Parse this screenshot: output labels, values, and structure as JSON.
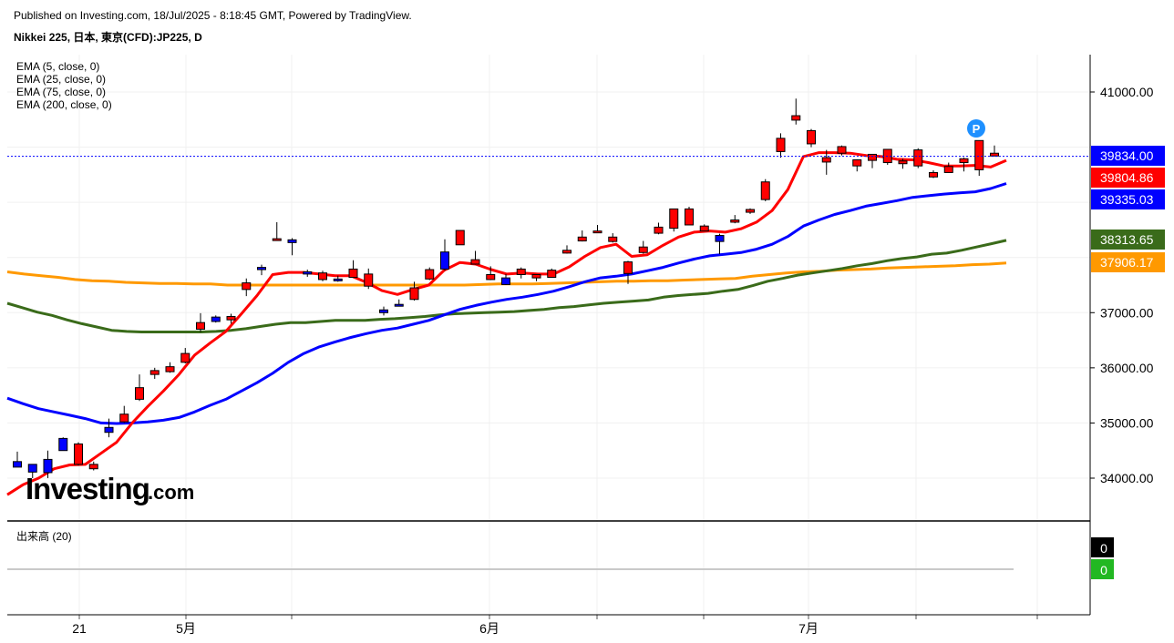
{
  "header": {
    "published": "Published on Investing.com, 18/Jul/2025 - 8:18:45 GMT, Powered by TradingView.",
    "symbol": "Nikkei 225, 日本, 東京(CFD):JP225, D"
  },
  "legend": [
    "EMA (5, close, 0)",
    "EMA (25, close, 0)",
    "EMA (75, close, 0)",
    "EMA (200, close, 0)"
  ],
  "volume_pane": {
    "label": "出来高 (20)",
    "values": [
      "0",
      "0"
    ],
    "colors": [
      "#000000",
      "#22b822"
    ]
  },
  "watermark": {
    "brand": "Investing",
    "suffix": ".com"
  },
  "marker_label": "P",
  "colors": {
    "up": "#ff0000",
    "down": "#0000ff",
    "ema5": "#ff0000",
    "ema25": "#0000ff",
    "ema75": "#3a6b1a",
    "ema200": "#ff9900",
    "current": "#0000ff"
  },
  "chart_data": {
    "type": "candlestick",
    "y_ticks": [
      "34000.00",
      "35000.00",
      "36000.00",
      "37000.00",
      "41000.00"
    ],
    "x_ticks": [
      "21",
      "5月",
      "6月",
      "7月"
    ],
    "ylim": [
      33150,
      41450
    ],
    "price_labels": [
      {
        "text": "39834.00",
        "value": 39834,
        "bg": "#0000ff"
      },
      {
        "text": "39804.86",
        "value": 39805,
        "bg": "#ff0000"
      },
      {
        "text": "39335.03",
        "value": 39335,
        "bg": "#0000ff"
      },
      {
        "text": "38313.65",
        "value": 38314,
        "bg": "#3a6b1a"
      },
      {
        "text": "37906.17",
        "value": 37906,
        "bg": "#ff9900"
      }
    ],
    "candles": [
      {
        "o": 34200,
        "h": 34480,
        "l": 34200,
        "c": 34300
      },
      {
        "o": 34110,
        "h": 34250,
        "l": 34000,
        "c": 34250
      },
      {
        "o": 34100,
        "h": 34500,
        "l": 34000,
        "c": 34340
      },
      {
        "o": 34500,
        "h": 34740,
        "l": 34500,
        "c": 34720
      },
      {
        "o": 34620,
        "h": 34650,
        "l": 34230,
        "c": 34250
      },
      {
        "o": 34250,
        "h": 34300,
        "l": 34140,
        "c": 34170
      },
      {
        "o": 34830,
        "h": 35080,
        "l": 34740,
        "c": 34920
      },
      {
        "o": 35160,
        "h": 35310,
        "l": 35000,
        "c": 35020
      },
      {
        "o": 35640,
        "h": 35880,
        "l": 35400,
        "c": 35430
      },
      {
        "o": 35950,
        "h": 36000,
        "l": 35800,
        "c": 35880
      },
      {
        "o": 36020,
        "h": 36100,
        "l": 35910,
        "c": 35930
      },
      {
        "o": 36260,
        "h": 36360,
        "l": 36080,
        "c": 36100
      },
      {
        "o": 36820,
        "h": 36990,
        "l": 36650,
        "c": 36700
      },
      {
        "o": 36840,
        "h": 36950,
        "l": 36820,
        "c": 36920
      },
      {
        "o": 36930,
        "h": 36980,
        "l": 36800,
        "c": 36870
      },
      {
        "o": 37540,
        "h": 37620,
        "l": 37300,
        "c": 37420
      },
      {
        "o": 37780,
        "h": 37870,
        "l": 37680,
        "c": 37820
      },
      {
        "o": 38340,
        "h": 38640,
        "l": 38320,
        "c": 38320
      },
      {
        "o": 38270,
        "h": 38350,
        "l": 38040,
        "c": 38320
      },
      {
        "o": 37700,
        "h": 37780,
        "l": 37650,
        "c": 37740
      },
      {
        "o": 37720,
        "h": 37760,
        "l": 37570,
        "c": 37600
      },
      {
        "o": 37590,
        "h": 37670,
        "l": 37560,
        "c": 37610
      },
      {
        "o": 37790,
        "h": 37950,
        "l": 37670,
        "c": 37640
      },
      {
        "o": 37700,
        "h": 37800,
        "l": 37430,
        "c": 37480
      },
      {
        "o": 37000,
        "h": 37110,
        "l": 36950,
        "c": 37050
      },
      {
        "o": 37150,
        "h": 37240,
        "l": 37170,
        "c": 37150
      },
      {
        "o": 37450,
        "h": 37560,
        "l": 37220,
        "c": 37240
      },
      {
        "o": 37780,
        "h": 37820,
        "l": 37590,
        "c": 37610
      },
      {
        "o": 37790,
        "h": 38330,
        "l": 37760,
        "c": 38100
      },
      {
        "o": 38490,
        "h": 38490,
        "l": 38270,
        "c": 38230
      },
      {
        "o": 37960,
        "h": 38120,
        "l": 37870,
        "c": 37880
      },
      {
        "o": 37690,
        "h": 37840,
        "l": 37590,
        "c": 37600
      },
      {
        "o": 37510,
        "h": 37700,
        "l": 37500,
        "c": 37630
      },
      {
        "o": 37790,
        "h": 37820,
        "l": 37620,
        "c": 37690
      },
      {
        "o": 37690,
        "h": 37660,
        "l": 37570,
        "c": 37630
      },
      {
        "o": 37770,
        "h": 37800,
        "l": 37650,
        "c": 37640
      },
      {
        "o": 38130,
        "h": 38220,
        "l": 38070,
        "c": 38080
      },
      {
        "o": 38370,
        "h": 38490,
        "l": 38290,
        "c": 38300
      },
      {
        "o": 38480,
        "h": 38590,
        "l": 38450,
        "c": 38450
      },
      {
        "o": 38370,
        "h": 38440,
        "l": 38270,
        "c": 38290
      },
      {
        "o": 37920,
        "h": 37940,
        "l": 37520,
        "c": 37710
      },
      {
        "o": 38190,
        "h": 38300,
        "l": 38070,
        "c": 38090
      },
      {
        "o": 38550,
        "h": 38630,
        "l": 38420,
        "c": 38440
      },
      {
        "o": 38880,
        "h": 38880,
        "l": 38470,
        "c": 38530
      },
      {
        "o": 38880,
        "h": 38920,
        "l": 38590,
        "c": 38590
      },
      {
        "o": 38570,
        "h": 38600,
        "l": 38490,
        "c": 38480
      },
      {
        "o": 38290,
        "h": 38430,
        "l": 38060,
        "c": 38400
      },
      {
        "o": 38680,
        "h": 38770,
        "l": 38620,
        "c": 38640
      },
      {
        "o": 38870,
        "h": 38890,
        "l": 38790,
        "c": 38820
      },
      {
        "o": 39370,
        "h": 39420,
        "l": 39020,
        "c": 39050
      },
      {
        "o": 40160,
        "h": 40250,
        "l": 39810,
        "c": 39920
      },
      {
        "o": 40570,
        "h": 40880,
        "l": 40410,
        "c": 40490
      },
      {
        "o": 40300,
        "h": 40330,
        "l": 40000,
        "c": 40060
      },
      {
        "o": 39810,
        "h": 39950,
        "l": 39500,
        "c": 39730
      },
      {
        "o": 40010,
        "h": 40030,
        "l": 39850,
        "c": 39890
      },
      {
        "o": 39770,
        "h": 39780,
        "l": 39560,
        "c": 39660
      },
      {
        "o": 39870,
        "h": 39870,
        "l": 39620,
        "c": 39760
      },
      {
        "o": 39960,
        "h": 39960,
        "l": 39680,
        "c": 39720
      },
      {
        "o": 39750,
        "h": 39790,
        "l": 39610,
        "c": 39700
      },
      {
        "o": 39950,
        "h": 39980,
        "l": 39620,
        "c": 39660
      },
      {
        "o": 39540,
        "h": 39580,
        "l": 39440,
        "c": 39460
      },
      {
        "o": 39650,
        "h": 39720,
        "l": 39550,
        "c": 39540
      },
      {
        "o": 39790,
        "h": 39810,
        "l": 39560,
        "c": 39720
      },
      {
        "o": 40120,
        "h": 40120,
        "l": 39480,
        "c": 39590
      },
      {
        "o": 39890,
        "h": 40030,
        "l": 39850,
        "c": 39840
      }
    ],
    "ema5": [
      33700,
      33880,
      34000,
      34170,
      34240,
      34250,
      34450,
      34650,
      35000,
      35300,
      35580,
      35880,
      36230,
      36450,
      36660,
      36980,
      37310,
      37690,
      37730,
      37730,
      37700,
      37670,
      37670,
      37550,
      37400,
      37330,
      37420,
      37500,
      37770,
      37910,
      37880,
      37780,
      37700,
      37720,
      37700,
      37700,
      37830,
      38020,
      38180,
      38240,
      38020,
      38050,
      38220,
      38370,
      38460,
      38480,
      38460,
      38520,
      38640,
      38850,
      39230,
      39830,
      39900,
      39900,
      39890,
      39850,
      39830,
      39780,
      39770,
      39720,
      39660,
      39660,
      39670,
      39640,
      39760
    ],
    "ema25": [
      35450,
      35350,
      35260,
      35200,
      35140,
      35080,
      35000,
      34990,
      35000,
      35020,
      35050,
      35100,
      35200,
      35320,
      35430,
      35580,
      35730,
      35900,
      36100,
      36260,
      36380,
      36470,
      36550,
      36620,
      36680,
      36720,
      36790,
      36860,
      36960,
      37060,
      37130,
      37190,
      37240,
      37280,
      37330,
      37390,
      37470,
      37560,
      37630,
      37660,
      37700,
      37760,
      37820,
      37900,
      37970,
      38030,
      38060,
      38090,
      38150,
      38240,
      38380,
      38570,
      38680,
      38780,
      38850,
      38930,
      38980,
      39030,
      39090,
      39120,
      39150,
      39170,
      39190,
      39250,
      39340
    ],
    "ema75": [
      37170,
      37090,
      37010,
      36950,
      36870,
      36800,
      36740,
      36680,
      36660,
      36650,
      36650,
      36650,
      36650,
      36650,
      36660,
      36680,
      36710,
      36750,
      36790,
      36820,
      36820,
      36840,
      36860,
      36860,
      36860,
      36880,
      36890,
      36910,
      36930,
      36960,
      36980,
      36990,
      37000,
      37010,
      37020,
      37040,
      37060,
      37090,
      37110,
      37140,
      37170,
      37190,
      37210,
      37230,
      37280,
      37310,
      37330,
      37350,
      37390,
      37420,
      37490,
      37570,
      37620,
      37680,
      37720,
      37760,
      37800,
      37850,
      37890,
      37940,
      37980,
      38010,
      38060,
      38080,
      38130,
      38190,
      38250,
      38310
    ],
    "ema200": [
      37740,
      37700,
      37670,
      37640,
      37600,
      37580,
      37570,
      37550,
      37540,
      37530,
      37530,
      37520,
      37520,
      37500,
      37500,
      37500,
      37500,
      37500,
      37500,
      37500,
      37500,
      37500,
      37500,
      37500,
      37500,
      37500,
      37500,
      37500,
      37510,
      37520,
      37520,
      37520,
      37530,
      37540,
      37550,
      37560,
      37570,
      37570,
      37580,
      37580,
      37590,
      37600,
      37610,
      37620,
      37660,
      37690,
      37720,
      37740,
      37750,
      37770,
      37780,
      37790,
      37810,
      37820,
      37830,
      37840,
      37850,
      37870,
      37880,
      37900
    ]
  }
}
